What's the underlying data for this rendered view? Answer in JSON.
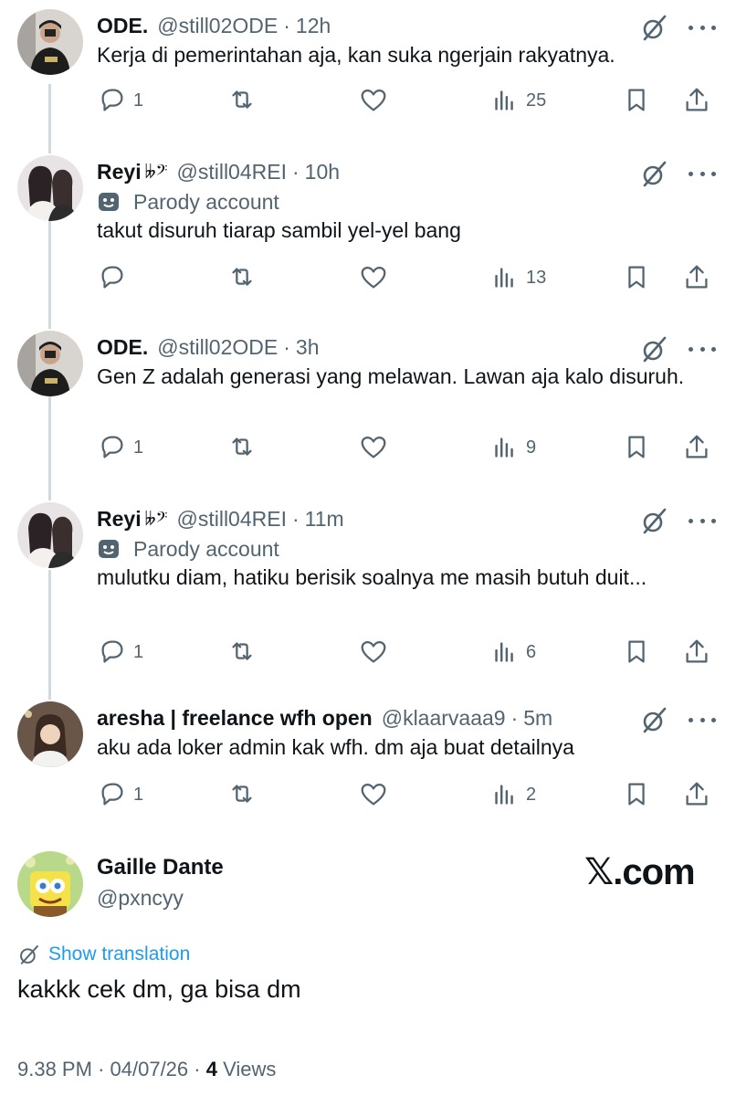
{
  "replies": [
    {
      "name": "ODE.",
      "glyph": "",
      "handle": "@still02ODE",
      "time": "12h",
      "parody": false,
      "text": "Kerja di pemerintahan aja, kan suka ngerjain rakyatnya.",
      "counts": {
        "reply": "1",
        "retweet": "",
        "like": "",
        "views": "25"
      },
      "avatar_icon": "ode-avatar"
    },
    {
      "name": "Reyi",
      "glyph": "𝄫𝄢",
      "handle": "@still04REI",
      "time": "10h",
      "parody": true,
      "parody_label": "Parody account",
      "text": "takut disuruh tiarap sambil yel-yel bang",
      "counts": {
        "reply": "",
        "retweet": "",
        "like": "",
        "views": "13"
      },
      "avatar_icon": "reyi-avatar"
    },
    {
      "name": "ODE.",
      "glyph": "",
      "handle": "@still02ODE",
      "time": "3h",
      "parody": false,
      "text": "Gen Z adalah generasi yang melawan. Lawan aja kalo disuruh.",
      "counts": {
        "reply": "1",
        "retweet": "",
        "like": "",
        "views": "9"
      },
      "avatar_icon": "ode-avatar"
    },
    {
      "name": "Reyi",
      "glyph": "𝄫𝄢",
      "handle": "@still04REI",
      "time": "11m",
      "parody": true,
      "parody_label": "Parody account",
      "text": "mulutku diam, hatiku berisik soalnya me masih butuh duit...",
      "counts": {
        "reply": "1",
        "retweet": "",
        "like": "",
        "views": "6"
      },
      "avatar_icon": "reyi-avatar"
    },
    {
      "name": "aresha | freelance wfh open",
      "glyph": "",
      "handle": "@klaarvaaa9",
      "time": "5m",
      "parody": false,
      "text": "aku ada loker admin kak wfh. dm aja buat detailnya",
      "counts": {
        "reply": "1",
        "retweet": "",
        "like": "",
        "views": "2"
      },
      "avatar_icon": "aresha-avatar"
    }
  ],
  "main_post": {
    "name": "Gaille Dante",
    "handle": "@pxncyy",
    "brand": "𝕏.com",
    "translation_label": "Show translation",
    "text": "kakkk cek dm, ga bisa dm",
    "time": "9.38 PM",
    "date": "04/07/26",
    "views_count": "4",
    "views_label": "Views",
    "separator": "·"
  },
  "colors": {
    "text": "#0f1419",
    "secondary": "#536471",
    "accent": "#1d9bf0",
    "thread_line": "#cfd9de"
  }
}
